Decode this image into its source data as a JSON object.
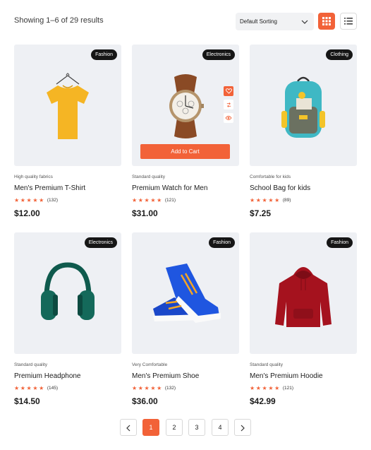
{
  "toolbar": {
    "results_text": "Showing 1–6 of 29 results",
    "sort_label": "Default Sorting",
    "sort_icon": "chevron-down-icon",
    "grid_view_icon": "grid-view-icon",
    "list_view_icon": "list-view-icon",
    "accent_color": "#f26238"
  },
  "products": [
    {
      "badge": "Fashion",
      "quality": "High quality fabrics",
      "name": "Men's Premium T-Shirt",
      "stars": "★★★★★",
      "reviews": "(132)",
      "price": "$12.00",
      "image": "yellow-tshirt"
    },
    {
      "badge": "Electronics",
      "quality": "Standard quality",
      "name": "Premium Watch for Men",
      "stars": "★★★★★",
      "reviews": "(121)",
      "price": "$31.00",
      "image": "wrist-watch",
      "cart_label": "Add to Cart",
      "actions": [
        "heart-icon",
        "compare-icon",
        "eye-icon"
      ]
    },
    {
      "badge": "Clothing",
      "quality": "Comfortable for kids",
      "name": "School Bag for kids",
      "stars": "★★★★★",
      "reviews": "(89)",
      "price": "$7.25",
      "image": "school-backpack"
    },
    {
      "badge": "Electronics",
      "quality": "Standard quality",
      "name": "Premium Headphone",
      "stars": "★★★★★",
      "reviews": "(145)",
      "price": "$14.50",
      "image": "headphones"
    },
    {
      "badge": "Fashion",
      "quality": "Very Comfortable",
      "name": "Men's Premium Shoe",
      "stars": "★★★★★",
      "reviews": "(132)",
      "price": "$36.00",
      "image": "blue-sneakers"
    },
    {
      "badge": "Fashion",
      "quality": "Standard quality",
      "name": "Men's Premium Hoodie",
      "stars": "★★★★★",
      "reviews": "(121)",
      "price": "$42.99",
      "image": "red-hoodie"
    }
  ],
  "pagination": {
    "prev_icon": "chevron-left-icon",
    "pages": [
      "1",
      "2",
      "3",
      "4"
    ],
    "current": "1",
    "next_icon": "chevron-right-icon"
  }
}
